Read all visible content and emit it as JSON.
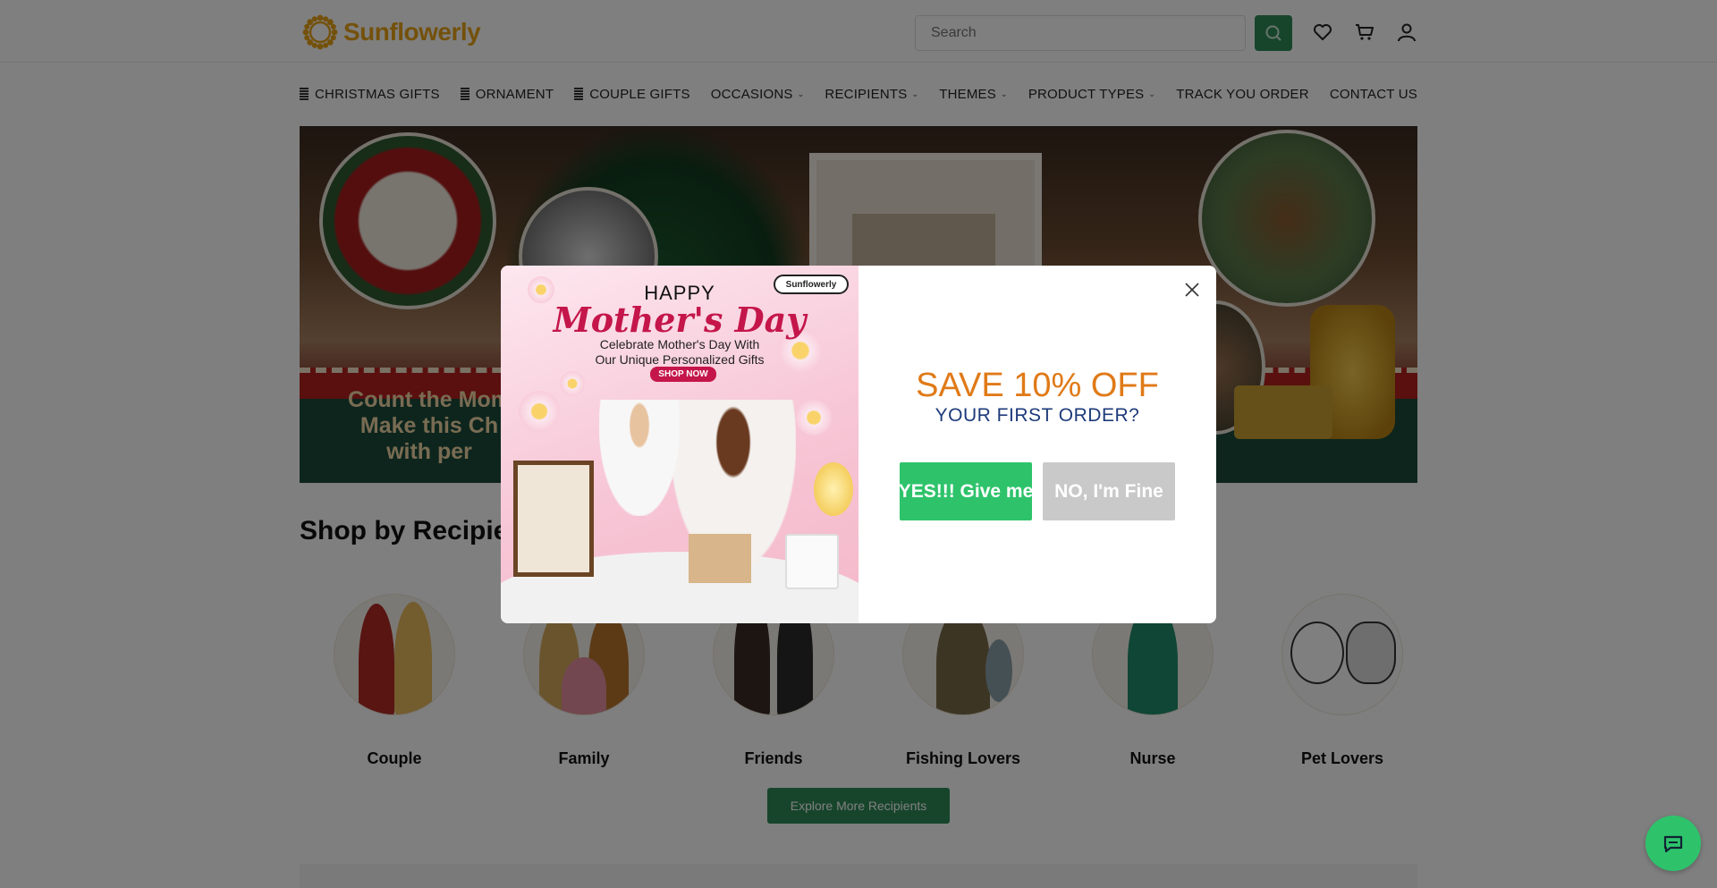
{
  "brand": {
    "name": "Sunflowerly",
    "accent": "#e8a317",
    "primary_green": "#2e8b57"
  },
  "search": {
    "placeholder": "Search"
  },
  "header_icons": [
    "wishlist-icon",
    "cart-icon",
    "account-icon"
  ],
  "nav": {
    "items": [
      {
        "label": "CHRISTMAS GIFTS",
        "prefix_icon": true,
        "dropdown": false
      },
      {
        "label": "ORNAMENT",
        "prefix_icon": true,
        "dropdown": false
      },
      {
        "label": "COUPLE GIFTS",
        "prefix_icon": true,
        "dropdown": false
      },
      {
        "label": "OCCASIONS",
        "prefix_icon": false,
        "dropdown": true
      },
      {
        "label": "RECIPIENTS",
        "prefix_icon": false,
        "dropdown": true
      },
      {
        "label": "THEMES",
        "prefix_icon": false,
        "dropdown": true
      },
      {
        "label": "PRODUCT TYPES",
        "prefix_icon": false,
        "dropdown": true
      },
      {
        "label": "TRACK YOU ORDER",
        "prefix_icon": false,
        "dropdown": false
      },
      {
        "label": "CONTACT US",
        "prefix_icon": false,
        "dropdown": false
      }
    ]
  },
  "hero": {
    "text_lines": [
      "Count the Mom",
      "Make this Ch",
      "with per"
    ]
  },
  "recipients_section": {
    "title": "Shop by Recipie",
    "items": [
      {
        "label": "Couple"
      },
      {
        "label": "Family"
      },
      {
        "label": "Friends"
      },
      {
        "label": "Fishing Lovers"
      },
      {
        "label": "Nurse"
      },
      {
        "label": "Pet Lovers"
      }
    ],
    "explore_label": "Explore More Recipients"
  },
  "popup": {
    "promo": {
      "badge": "Sunflowerly",
      "happy": "HAPPY",
      "headline": "Mother's Day",
      "line1": "Celebrate Mother's Day With",
      "line2": "Our Unique Personalized Gifts",
      "cta": "SHOP NOW"
    },
    "offer_title": "SAVE 10% OFF",
    "offer_subtitle": "YOUR FIRST ORDER?",
    "yes_label": "YES!!! Give me",
    "no_label": "NO, I'm Fine",
    "offer_color": "#e07a18",
    "yes_color": "#2ec36b",
    "no_color": "#c9c9c9"
  },
  "chat": {
    "icon": "chat-icon"
  }
}
